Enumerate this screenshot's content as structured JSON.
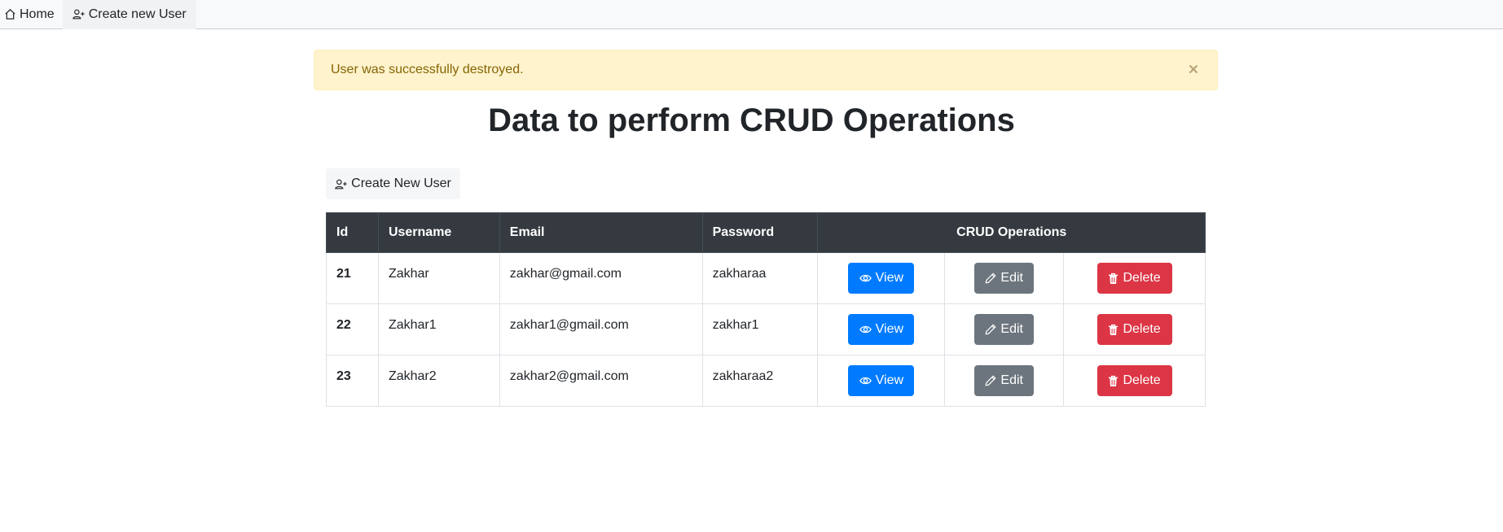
{
  "nav": {
    "home_label": "Home",
    "create_label": "Create new User"
  },
  "alert": {
    "message": "User was successfully destroyed.",
    "close_symbol": "×"
  },
  "title": "Data to perform CRUD Operations",
  "create_button_label": "Create New User",
  "table": {
    "headers": {
      "id": "Id",
      "username": "Username",
      "email": "Email",
      "password": "Password",
      "ops": "CRUD Operations"
    },
    "rows": [
      {
        "id": "21",
        "username": "Zakhar",
        "email": "zakhar@gmail.com",
        "password": "zakharaa"
      },
      {
        "id": "22",
        "username": "Zakhar1",
        "email": "zakhar1@gmail.com",
        "password": "zakhar1"
      },
      {
        "id": "23",
        "username": "Zakhar2",
        "email": "zakhar2@gmail.com",
        "password": "zakharaa2"
      }
    ],
    "actions": {
      "view": "View",
      "edit": "Edit",
      "delete": "Delete"
    }
  },
  "colors": {
    "view": "#007bff",
    "edit": "#6c757d",
    "delete": "#dc3545",
    "header": "#343a40",
    "alert_bg": "#fff3cd",
    "alert_text": "#856404"
  }
}
